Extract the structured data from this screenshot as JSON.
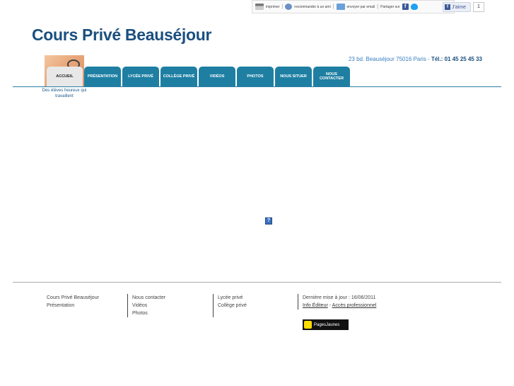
{
  "toolbar": {
    "print": "imprimer",
    "recommend": "recommander à un ami",
    "email": "envoyer par email",
    "share": "Partager sur",
    "like": "J'aime",
    "like_count": "1"
  },
  "header": {
    "title": "Cours Privé Beauséjour",
    "address": "23 bd. Beauséjour 75016 Paris",
    "address_sep": " - ",
    "phone": "Tél.: 01 45 25 45 33"
  },
  "nav": {
    "items": [
      {
        "label": "ACCUEIL"
      },
      {
        "label": "PRÉSENTATION"
      },
      {
        "label": "LYCÉE PRIVÉ"
      },
      {
        "label": "COLLÈGE PRIVÉ"
      },
      {
        "label": "VIDÉOS"
      },
      {
        "label": "PHOTOS"
      },
      {
        "label": "NOUS SITUER"
      },
      {
        "label": "NOUS CONTACTER"
      }
    ]
  },
  "sidebar": {
    "caption": "Des élèves heureux qui travaillent"
  },
  "content": {
    "help_icon": "?"
  },
  "footer": {
    "col1": [
      "Cours Privé Beauséjour",
      "Présentation"
    ],
    "col2": [
      "Nous contacter",
      "Vidéos",
      "Photos"
    ],
    "col3": [
      "Lycée privé",
      "Collège privé"
    ],
    "updated": "Dernière mise à jour : 16/06/2011",
    "info_editeur": "Info Éditeur",
    "link_sep": " - ",
    "acces_pro": "Accès professionnel",
    "badge": "PagesJaunes"
  }
}
